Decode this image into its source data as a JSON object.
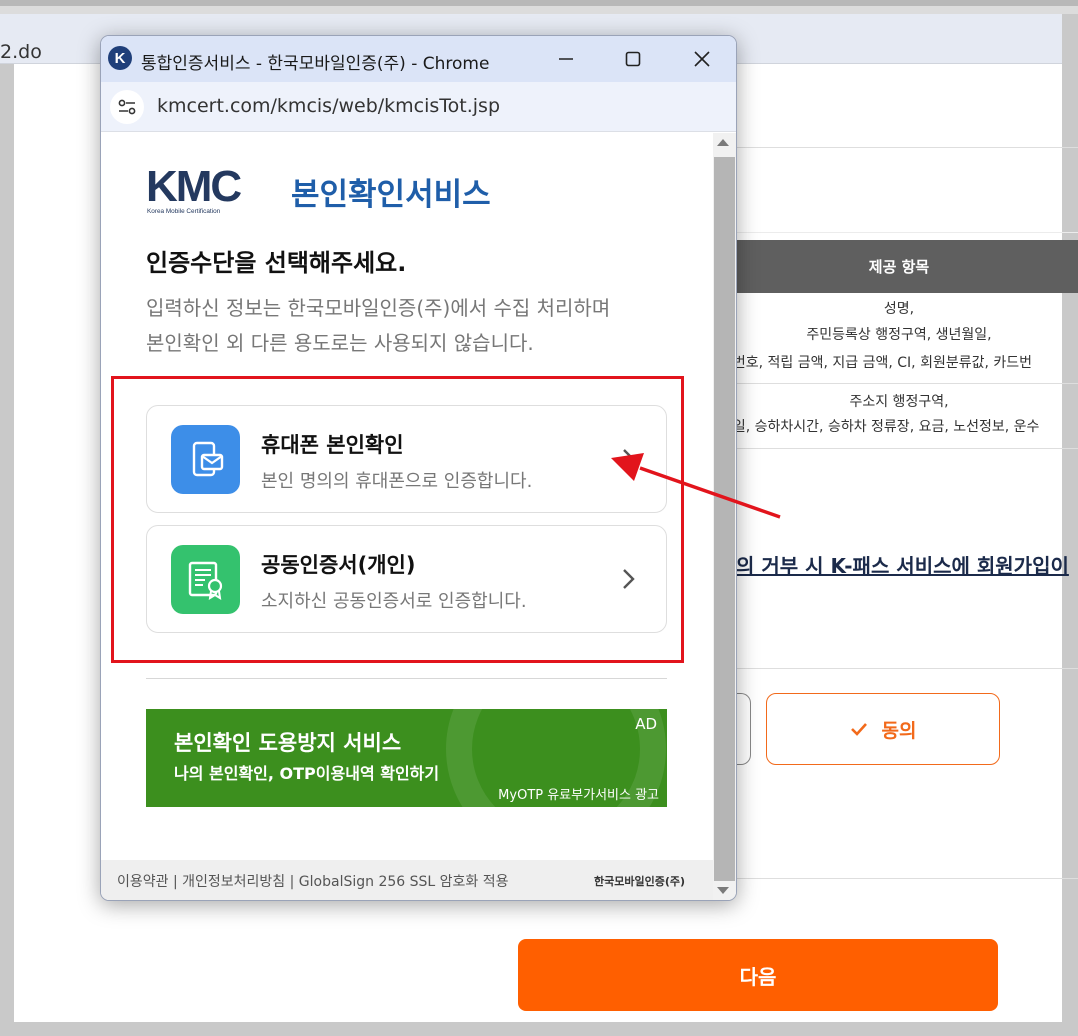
{
  "background": {
    "url_fragment": "2.do",
    "table": {
      "header": "제공 항목",
      "row1": [
        "성명,",
        "주민등록상 행정구역, 생년월일,",
        "폰번호, 적립 금액, 지급 금액, CI, 회원분류값, 카드번"
      ],
      "row2": [
        "주소지 행정구역,",
        "월일, 승하차시간, 승하차 정류장, 요금, 노선정보, 운수"
      ]
    },
    "notice": "의 거부 시 K-패스 서비스에 회원가입이",
    "agree_button": "동의",
    "next_button": "다음"
  },
  "popup": {
    "window_title": "통합인증서비스 - 한국모바일인증(주) - Chrome",
    "url": "kmcert.com/kmcis/web/kmcisTot.jsp",
    "logo_text": "KMC",
    "logo_subtext": "Korea Mobile Certification",
    "service_name": "본인확인서비스",
    "heading": "인증수단을 선택해주세요.",
    "description_line1": "입력하신 정보는 한국모바일인증(주)에서 수집 처리하며",
    "description_line2": "본인확인 외 다른 용도로는 사용되지 않습니다.",
    "methods": [
      {
        "title": "휴대폰 본인확인",
        "description": "본인 명의의 휴대폰으로 인증합니다.",
        "icon": "mobile-phone-icon",
        "color": "#3d8ee8"
      },
      {
        "title": "공동인증서(개인)",
        "description": "소지하신 공동인증서로 인증합니다.",
        "icon": "certificate-icon",
        "color": "#34c26e"
      }
    ],
    "ad": {
      "title": "본인확인 도용방지 서비스",
      "subtitle": "나의 본인확인, OTP이용내역 확인하기",
      "tag": "AD",
      "footer": "MyOTP 유료부가서비스 광고"
    },
    "footer_links": "이용약관 | 개인정보처리방침 | GlobalSign 256 SSL 암호화 적용",
    "footer_brand": "한국모바일인증(주)"
  },
  "colors": {
    "accent_orange": "#ff5f00",
    "kmc_blue": "#1f5ea9",
    "highlight_red": "#e2141c",
    "ad_green": "#3c8f1e"
  }
}
